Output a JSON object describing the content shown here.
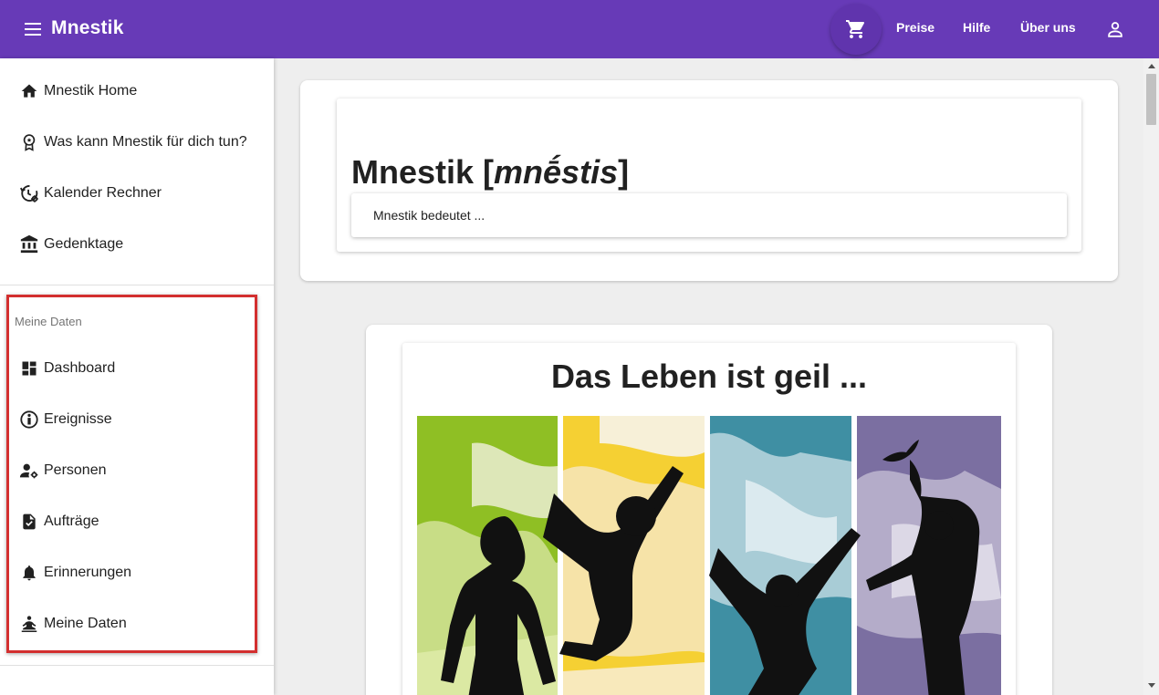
{
  "app": {
    "title": "Mnestik"
  },
  "toolbar": {
    "links": [
      {
        "label": "Preise"
      },
      {
        "label": "Hilfe"
      },
      {
        "label": "Über uns"
      }
    ]
  },
  "sidebar": {
    "items": [
      {
        "label": "Mnestik Home",
        "icon": "home-icon"
      },
      {
        "label": "Was kann Mnestik für dich tun?",
        "icon": "award-icon"
      },
      {
        "label": "Kalender Rechner",
        "icon": "history-settings-icon"
      },
      {
        "label": "Gedenktage",
        "icon": "institution-icon"
      }
    ],
    "section_title": "Meine Daten",
    "section_items": [
      {
        "label": "Dashboard",
        "icon": "dashboard-icon"
      },
      {
        "label": "Ereignisse",
        "icon": "info-icon"
      },
      {
        "label": "Personen",
        "icon": "person-settings-icon"
      },
      {
        "label": "Aufträge",
        "icon": "task-document-icon"
      },
      {
        "label": "Erinnerungen",
        "icon": "bell-icon"
      },
      {
        "label": "Meine Daten",
        "icon": "self-care-icon"
      }
    ]
  },
  "main": {
    "card1": {
      "title_prefix": "Mnestik [",
      "title_phonetic": "mnḗstis",
      "title_suffix": "]",
      "panel_label": "Mnestik bedeutet ..."
    },
    "card2": {
      "title": "Das Leben ist geil ..."
    }
  },
  "colors": {
    "primary": "#673ab7",
    "highlight_border": "#d32f2f",
    "panel_green": "#8fbf24",
    "panel_yellow": "#f5d033",
    "panel_teal": "#3f8fa3",
    "panel_purple": "#7b6fa1"
  }
}
